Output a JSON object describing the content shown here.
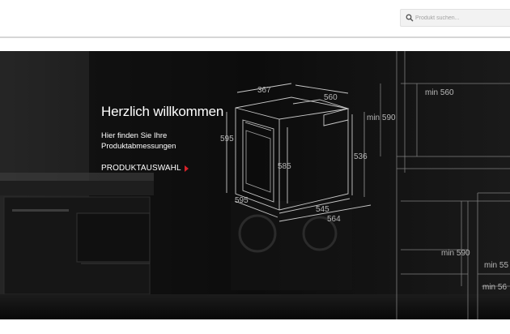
{
  "search": {
    "placeholder": "Produkt suchen..."
  },
  "hero": {
    "title": "Herzlich willkommen",
    "subtitle": "Hier finden Sie Ihre Produktabmessungen",
    "cta_label": "PRODUKTAUSWAHL",
    "cta_arrow_color": "#d8232a"
  },
  "dimensions": {
    "oven_top_depth": "367",
    "oven_top_width": "560",
    "oven_left_height": "595",
    "oven_inner_height": "585",
    "oven_right_height": "536",
    "oven_front_width": "595",
    "oven_bottom_depth": "545",
    "oven_bottom_width": "564",
    "niche_top_width": "min 560",
    "niche_top_height": "min 590",
    "niche_bottom_height": "min 590",
    "niche_bottom_width_1": "min 55",
    "niche_bottom_width_2": "min 56"
  }
}
